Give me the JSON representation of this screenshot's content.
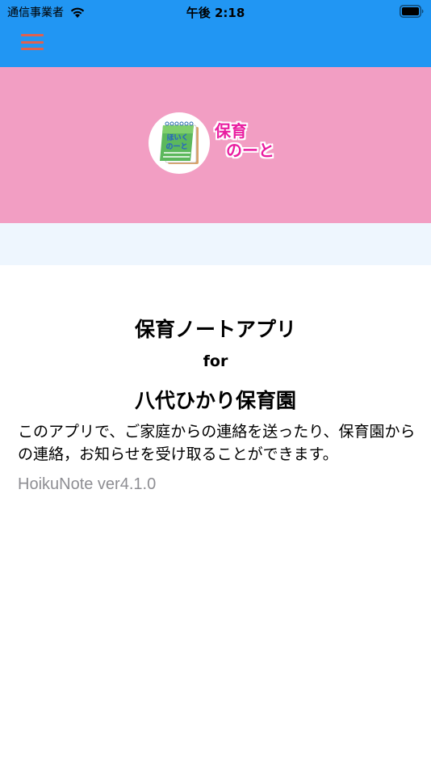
{
  "status_bar": {
    "carrier": "通信事業者",
    "time": "午後 2:18",
    "wifi_icon": "wifi-icon",
    "battery_icon": "battery-full-icon"
  },
  "header": {
    "menu_icon": "hamburger-menu-icon",
    "background_color": "#2196f3",
    "menu_color": "#e0614f"
  },
  "banner": {
    "background_color": "#f29ec3",
    "logo_icon": "notebook-logo-icon",
    "logo_notebook_text_line1": "ほいく",
    "logo_notebook_text_line2": "のーと",
    "logo_text_line1": "保育",
    "logo_text_line2": "のーと",
    "logo_text_color": "#e91ea0"
  },
  "main": {
    "title": "保育ノートアプリ",
    "for": "for",
    "org_name": "八代ひかり保育園",
    "description": "このアプリで、ご家庭からの連絡を送ったり、保育園からの連絡，お知らせを受け取ることができます。",
    "version": "HoikuNote ver4.1.0"
  }
}
